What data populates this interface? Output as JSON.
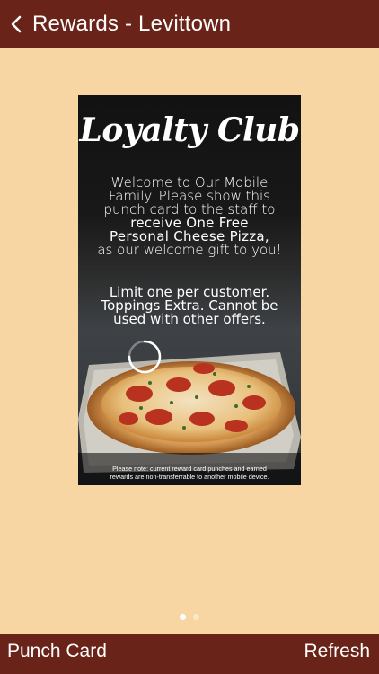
{
  "navbar": {
    "back_icon": "chevron-left-icon",
    "title": "Rewards - Levittown"
  },
  "card": {
    "title": "Loyalty Club",
    "welcome_lines": [
      "Welcome to Our Mobile",
      "Family. Please show this",
      "punch card to the staff to",
      "receive One Free",
      "Personal Cheese Pizza,",
      "as our welcome gift to you!"
    ],
    "limit_lines": [
      "Limit one per customer.",
      "Toppings Extra. Cannot be",
      "used with other offers."
    ],
    "note_lines": [
      "Please note: current reward card punches and earned",
      "rewards are non-transferrable to another mobile device."
    ],
    "loading_icon": "loading-spinner-icon"
  },
  "pager": {
    "current_page": 1,
    "total_pages": 2
  },
  "toolbar": {
    "left_label": "Punch Card",
    "right_label": "Refresh"
  },
  "colors": {
    "bar": "#6a2318",
    "background": "#f7d6a3"
  }
}
